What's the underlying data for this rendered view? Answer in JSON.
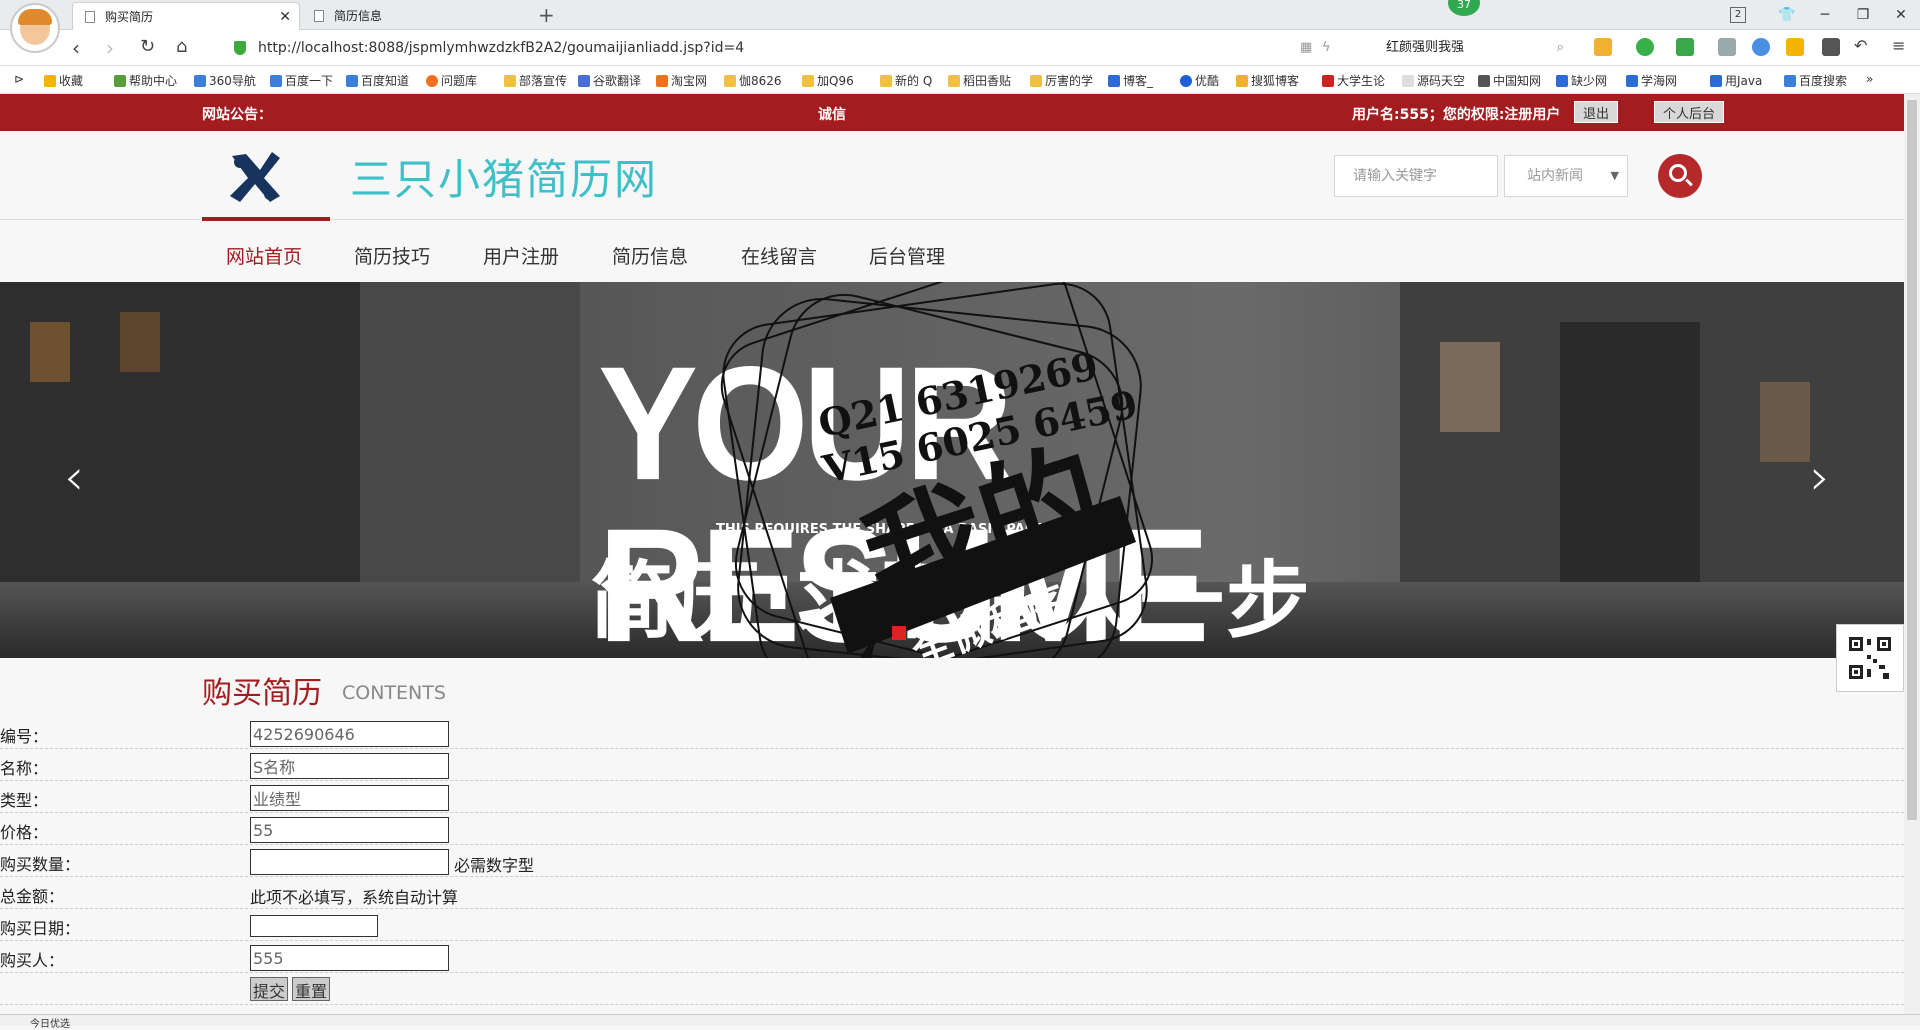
{
  "browser": {
    "tabs": [
      {
        "label": "购买简历"
      },
      {
        "label": "简历信息"
      }
    ],
    "notification_count": "37",
    "tab_count": "2",
    "url": "http://localhost:8088/jspmlymhwzdzkfB2A2/goumaijianliadd.jsp?id=4",
    "search_text": "红颜强则我强",
    "bookmarks": [
      "收藏",
      "帮助中心",
      "360导航",
      "百度一下",
      "百度知道",
      "问题库",
      "部落宣传",
      "谷歌翻译",
      "淘宝网",
      "伽8626",
      "加Q96",
      "新的 Q",
      "稻田香贴",
      "厉害的学",
      "博客_",
      "优酷",
      "搜狐博客",
      "大学生论",
      "源码天空",
      "中国知网",
      "缺少网",
      "学海网",
      "用Java",
      "百度搜索"
    ]
  },
  "notice": {
    "label": "网站公告：",
    "text": "诚信",
    "user_text": "用户名:555；您的权限:注册用户",
    "logout_label": "退出",
    "admin_label": "个人后台"
  },
  "site": {
    "title": "三只小猪简历网",
    "search_placeholder": "请输入关键字",
    "search_scope": "站内新闻"
  },
  "nav": [
    {
      "label": "网站首页"
    },
    {
      "label": "简历技巧"
    },
    {
      "label": "用户注册"
    },
    {
      "label": "简历信息"
    },
    {
      "label": "在线留言"
    },
    {
      "label": "后台管理"
    }
  ],
  "banner": {
    "headline": "YOUR RESUME",
    "subline": "THIS REQUIRES THE SHAPE OF A BASIC PARAGRAPH",
    "cn_text": "简历·求职快人一步",
    "stamp_text": "全微程序",
    "stamp_big": "我的",
    "qq": "Q21 6319269",
    "wx": "V15 6025 6459"
  },
  "section": {
    "title": "购买简历",
    "subtitle": "CONTENTS"
  },
  "form": {
    "fields": [
      {
        "label": "编号：",
        "value": "4252690646"
      },
      {
        "label": "名称：",
        "value": "S名称"
      },
      {
        "label": "类型：",
        "value": "业绩型"
      },
      {
        "label": "价格：",
        "value": "55"
      },
      {
        "label": "购买数量：",
        "value": "",
        "hint": "必需数字型"
      },
      {
        "label": "总金额：",
        "note": "此项不必填写，系统自动计算"
      },
      {
        "label": "购买日期：",
        "value": ""
      },
      {
        "label": "购买人：",
        "value": "555"
      }
    ],
    "submit_label": "提交",
    "reset_label": "重置"
  },
  "status": {
    "left": "今日优选"
  }
}
